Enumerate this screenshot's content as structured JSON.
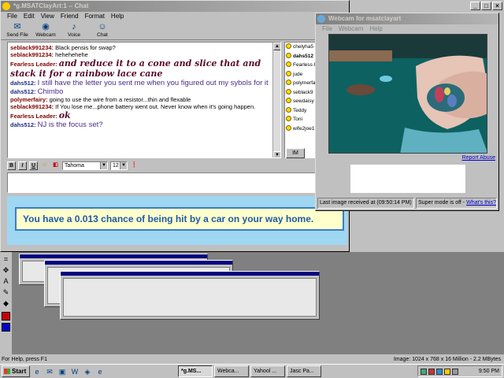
{
  "chat_window": {
    "title": "*g.MSATClayArt:1 -- Chat",
    "menu": [
      "File",
      "Edit",
      "View",
      "Friend",
      "Format",
      "Help"
    ],
    "toolbar": [
      "Send File",
      "Webcam",
      "Voice",
      "Chat"
    ],
    "messages": [
      {
        "nick": "seblack991234:",
        "text": "Black pensis for swap?",
        "style": "normal"
      },
      {
        "nick": "seblack991234:",
        "text": "hehehehehe",
        "style": "normal"
      },
      {
        "nick": "Fearless Leader:",
        "text": "and reduce it to a cone and slice that and stack it for a rainbow lace cane",
        "style": "fancy"
      },
      {
        "nick": "dahs512:",
        "text": "I still have the letter you sent me when you figured out my sybols for it",
        "style": "big"
      },
      {
        "nick": "dahs512:",
        "text": "Chimbo",
        "style": "big"
      },
      {
        "nick": "polymerfairy:",
        "text": "going to use the wire from a resistor...thin and flexable",
        "style": "normal"
      },
      {
        "nick": "seblack991234:",
        "text": "If You lose me...phone battery went out. Never know when it's going happen.",
        "style": "normal"
      },
      {
        "nick": "Fearless Leader:",
        "text": "ok",
        "style": "fancy"
      },
      {
        "nick": "dahs512:",
        "text": "NJ is the focus set?",
        "style": "big"
      }
    ],
    "users": [
      {
        "name": "chelyha5",
        "bold": false
      },
      {
        "name": "dahs512",
        "bold": true
      },
      {
        "name": "Fearless I",
        "bold": false
      },
      {
        "name": "jude",
        "bold": false
      },
      {
        "name": "polymerfa",
        "bold": false
      },
      {
        "name": "seblack9",
        "bold": false
      },
      {
        "name": "sewdaisy",
        "bold": false
      },
      {
        "name": "Teddy",
        "bold": false
      },
      {
        "name": "Toni",
        "bold": false
      },
      {
        "name": "wife2joe1",
        "bold": false
      }
    ],
    "im_label": "IM",
    "format": {
      "bold": "B",
      "italic": "I",
      "underline": "U",
      "font": "Tahoma",
      "size": "12"
    },
    "ad_text": "You have a 0.013 chance of being hit by a car on your way home."
  },
  "webcam_window": {
    "title": "Webcam for msatclayart",
    "menu": [
      "File",
      "Webcam",
      "Help"
    ],
    "report_link": "Report Abuse",
    "status_received": "Last image received at (09:50:14 PM)",
    "status_super": "Super mode is off -",
    "status_link": "What's this?"
  },
  "background_app": {
    "status_left": "For Help, press F1",
    "status_right": "Image:  1024 x 768 x 16 Million - 2.2 MBytes"
  },
  "taskbar": {
    "start_label": "Start",
    "tasks": [
      "*g.MS...",
      "Webca...",
      "Yahool ...",
      "Jasc Pa..."
    ],
    "clock": "9:50 PM"
  },
  "colors": {
    "title_active": "#000080",
    "ad_banner_text": "#1d5aa6",
    "ad_background": "#9fd6f2",
    "webcam_teal": "#0d5a5a"
  }
}
